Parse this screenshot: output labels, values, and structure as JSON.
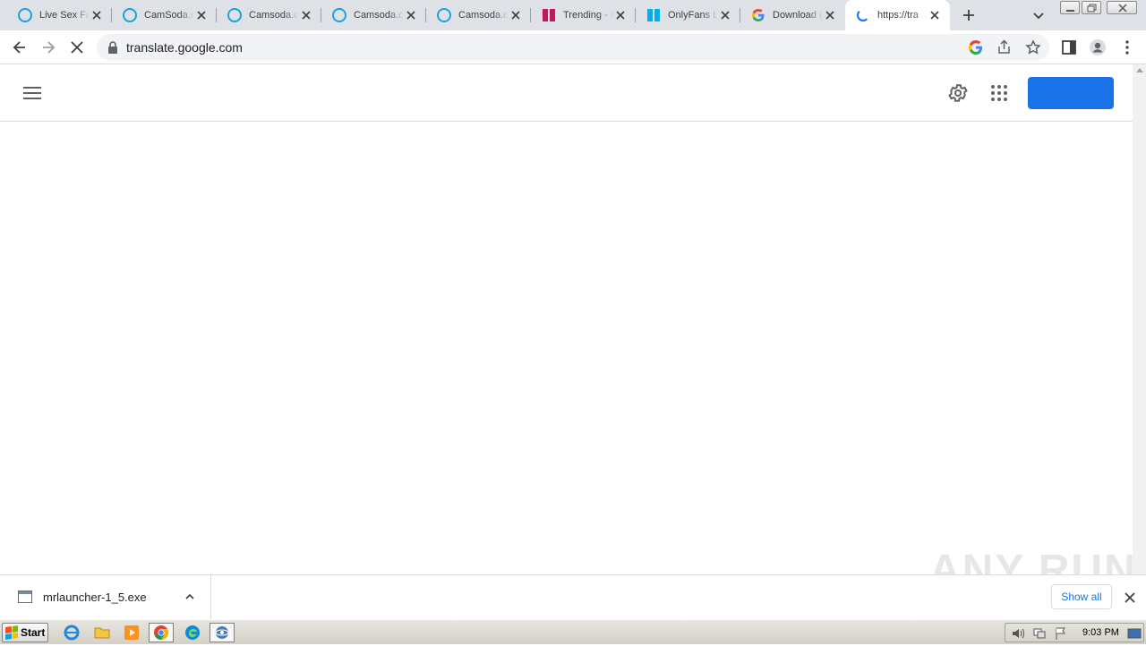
{
  "tabs": [
    {
      "title": "Live Sex Fr",
      "favicon": "camsoda-icon"
    },
    {
      "title": "CamSoda.c",
      "favicon": "camsoda-icon"
    },
    {
      "title": "Camsoda.c",
      "favicon": "camsoda-icon"
    },
    {
      "title": "Camsoda.c",
      "favicon": "camsoda-icon"
    },
    {
      "title": "Camsoda.c",
      "favicon": "camsoda-icon"
    },
    {
      "title": "Trending - I",
      "favicon": "trending-icon"
    },
    {
      "title": "OnlyFans L",
      "favicon": "onlyfans-icon"
    },
    {
      "title": "Download (",
      "favicon": "google-icon"
    },
    {
      "title": "https://tra",
      "favicon": "loading-spinner-icon"
    }
  ],
  "toolbar": {
    "url": "translate.google.com"
  },
  "download_bar": {
    "filename": "mrlauncher-1_5.exe",
    "show_all_label": "Show all"
  },
  "watermark": "ANY RUN",
  "taskbar": {
    "start_label": "Start",
    "clock": "9:03 PM"
  },
  "colors": {
    "accent": "#1a73e8",
    "tabstrip": "#dee1e6",
    "camsoda": "#1ba1e2",
    "trending": "#c2185b",
    "onlyfans": "#00aff0"
  }
}
